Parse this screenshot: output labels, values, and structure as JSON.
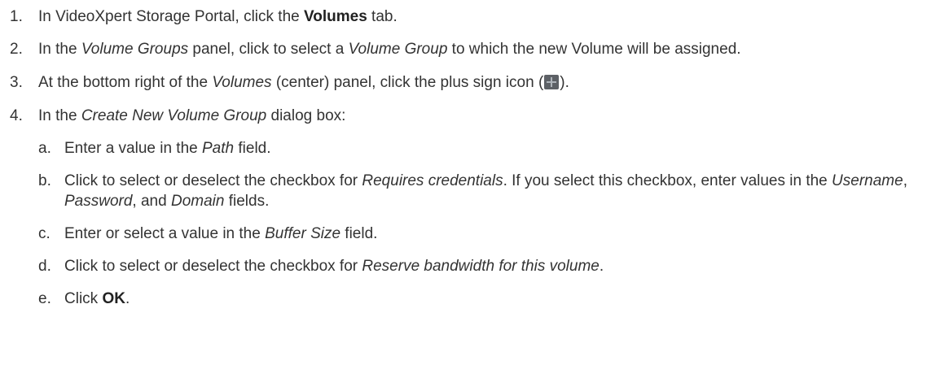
{
  "steps": [
    {
      "num": "1.",
      "t1": "In VideoXpert Storage Portal, click the ",
      "b1": "Volumes",
      "t2": " tab."
    },
    {
      "num": "2.",
      "t1": "In the ",
      "i1": "Volume Groups",
      "t2": " panel, click to select a ",
      "i2": "Volume Group",
      "t3": " to which the new Volume will be assigned."
    },
    {
      "num": "3.",
      "t1": "At the bottom right of the ",
      "i1": "Volumes",
      "t2": " (center) panel, click the plus sign icon (",
      "t3": ")."
    },
    {
      "num": "4.",
      "t1": "In the ",
      "i1": "Create New Volume Group",
      "t2": " dialog box:"
    }
  ],
  "substeps": [
    {
      "num": "a.",
      "t1": "Enter a value in the ",
      "i1": "Path",
      "t2": " field."
    },
    {
      "num": "b.",
      "t1": "Click to select or deselect the checkbox for ",
      "i1": "Requires credentials",
      "t2": ". If you select this checkbox, enter values in the ",
      "i2": "Username",
      "t3": ", ",
      "i3": "Password",
      "t4": ", and ",
      "i4": "Domain",
      "t5": " fields."
    },
    {
      "num": "c.",
      "t1": "Enter or select a value in the ",
      "i1": "Buffer Size",
      "t2": " field."
    },
    {
      "num": "d.",
      "t1": "Click to select or deselect the checkbox for ",
      "i1": "Reserve bandwidth for this volume",
      "t2": "."
    },
    {
      "num": "e.",
      "t1": "Click ",
      "b1": "OK",
      "t2": "."
    }
  ],
  "icons": {
    "plus": "plus-sign-icon"
  },
  "colors": {
    "text": "#333333",
    "icon_bg": "#5d6166",
    "icon_fg": "#aeb4ba"
  }
}
